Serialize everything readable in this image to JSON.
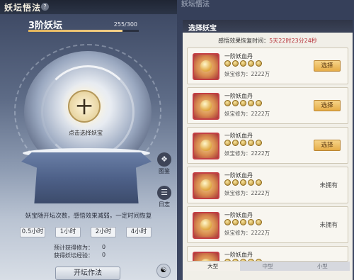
{
  "left": {
    "title": "妖坛悟法",
    "help_icon": "?",
    "level_name": "3阶妖坛",
    "progress_text": "255/300",
    "progress_value": 0.85,
    "center_glyph": "十",
    "center_label": "点击选择妖宝",
    "side": {
      "atlas": "图鉴",
      "log": "日志"
    },
    "description": "妖宝随开坛次数，感悟效果减弱，一定时间恢复",
    "durations": [
      "0.5小时",
      "1小时",
      "2小时",
      "4小时"
    ],
    "stats": [
      {
        "label": "预计获得修为：",
        "value": "0"
      },
      {
        "label": "获得妖坛经验：",
        "value": "0"
      }
    ],
    "start_button": "开坛作法"
  },
  "right": {
    "ghost_title": "妖坛悟法",
    "dialog_title": "选择妖宝",
    "recover_label": "感悟效果恢复时间：",
    "recover_time": "5天22时23分24秒",
    "cards": [
      {
        "name": "一阶妖血丹",
        "power": "妖宝修为：2222万",
        "action": "选择"
      },
      {
        "name": "一阶妖血丹",
        "power": "妖宝修为：2222万",
        "action": "选择"
      },
      {
        "name": "一阶妖血丹",
        "power": "妖宝修为：2222万",
        "action": "选择"
      },
      {
        "name": "一阶妖血丹",
        "power": "妖宝修为：2222万",
        "action": "未拥有"
      },
      {
        "name": "一阶妖血丹",
        "power": "妖宝修为：2222万",
        "action": "未拥有"
      },
      {
        "name": "一阶妖血丹",
        "power": "",
        "action": ""
      }
    ],
    "tabs": [
      "大型",
      "中型",
      "小型"
    ]
  }
}
